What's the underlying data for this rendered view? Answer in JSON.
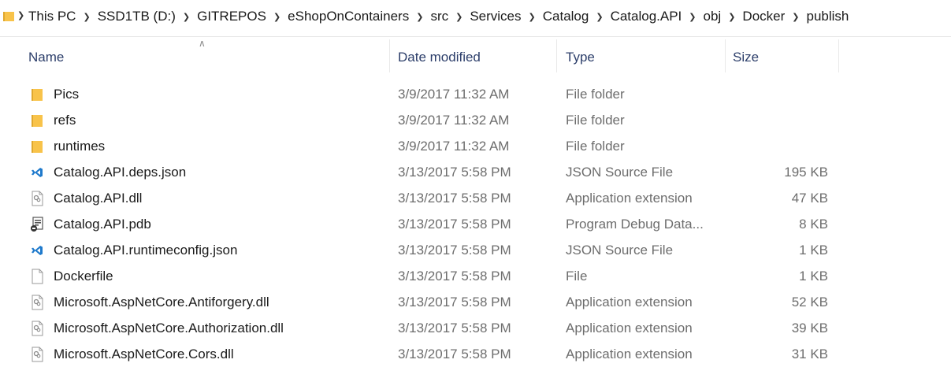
{
  "breadcrumb": {
    "items": [
      "This PC",
      "SSD1TB (D:)",
      "GITREPOS",
      "eShopOnContainers",
      "src",
      "Services",
      "Catalog",
      "Catalog.API",
      "obj",
      "Docker",
      "publish"
    ]
  },
  "columns": {
    "name": "Name",
    "date": "Date modified",
    "type": "Type",
    "size": "Size"
  },
  "files": [
    {
      "name": "Pics",
      "date": "3/9/2017 11:32 AM",
      "type": "File folder",
      "size": "",
      "icon": "folder-icon"
    },
    {
      "name": "refs",
      "date": "3/9/2017 11:32 AM",
      "type": "File folder",
      "size": "",
      "icon": "folder-icon"
    },
    {
      "name": "runtimes",
      "date": "3/9/2017 11:32 AM",
      "type": "File folder",
      "size": "",
      "icon": "folder-icon"
    },
    {
      "name": "Catalog.API.deps.json",
      "date": "3/13/2017 5:58 PM",
      "type": "JSON Source File",
      "size": "195 KB",
      "icon": "vscode-json-icon"
    },
    {
      "name": "Catalog.API.dll",
      "date": "3/13/2017 5:58 PM",
      "type": "Application extension",
      "size": "47 KB",
      "icon": "dll-icon"
    },
    {
      "name": "Catalog.API.pdb",
      "date": "3/13/2017 5:58 PM",
      "type": "Program Debug Data...",
      "size": "8 KB",
      "icon": "pdb-icon"
    },
    {
      "name": "Catalog.API.runtimeconfig.json",
      "date": "3/13/2017 5:58 PM",
      "type": "JSON Source File",
      "size": "1 KB",
      "icon": "vscode-json-icon"
    },
    {
      "name": "Dockerfile",
      "date": "3/13/2017 5:58 PM",
      "type": "File",
      "size": "1 KB",
      "icon": "blank-file-icon"
    },
    {
      "name": "Microsoft.AspNetCore.Antiforgery.dll",
      "date": "3/13/2017 5:58 PM",
      "type": "Application extension",
      "size": "52 KB",
      "icon": "dll-icon"
    },
    {
      "name": "Microsoft.AspNetCore.Authorization.dll",
      "date": "3/13/2017 5:58 PM",
      "type": "Application extension",
      "size": "39 KB",
      "icon": "dll-icon"
    },
    {
      "name": "Microsoft.AspNetCore.Cors.dll",
      "date": "3/13/2017 5:58 PM",
      "type": "Application extension",
      "size": "31 KB",
      "icon": "dll-icon"
    }
  ],
  "colors": {
    "folder": "#f8c34a",
    "folder_dark": "#e0a82e",
    "header_text": "#2c3e6a",
    "secondary_text": "#6d6d6d",
    "vscode_blue": "#1f7acc"
  }
}
